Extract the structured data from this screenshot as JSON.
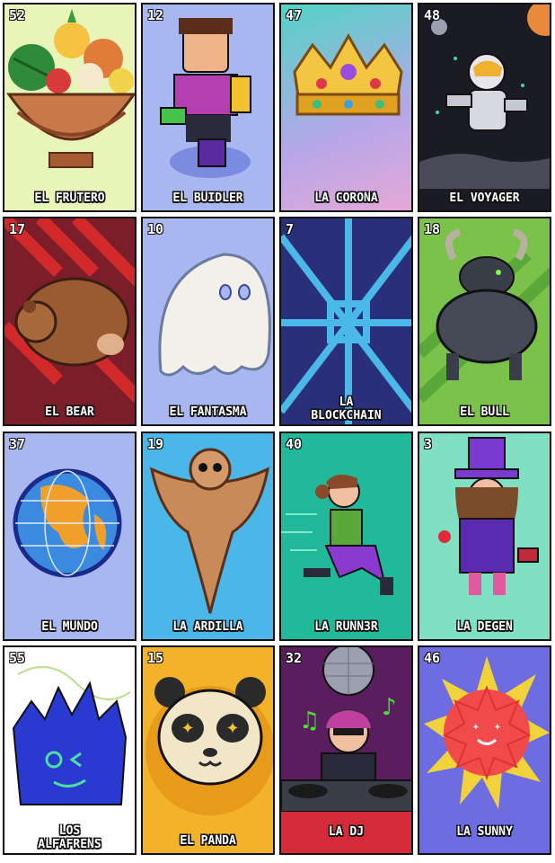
{
  "cards": [
    {
      "number": "52",
      "title": "EL FRUTERO",
      "bg": "#e8f4b8"
    },
    {
      "number": "12",
      "title": "EL BUIDLER",
      "bg": "#a9b7f0"
    },
    {
      "number": "47",
      "title": "LA CORONA",
      "bg": "#b6a7e9"
    },
    {
      "number": "48",
      "title": "EL VOYAGER",
      "bg": "#1b1b24"
    },
    {
      "number": "17",
      "title": "EL BEAR",
      "bg": "#7c1e2a"
    },
    {
      "number": "10",
      "title": "EL FANTASMA",
      "bg": "#a9b7f0"
    },
    {
      "number": "7",
      "title": "LA\nBLOCKCHAIN",
      "bg": "#2a2f7a"
    },
    {
      "number": "18",
      "title": "EL BULL",
      "bg": "#7ac24a"
    },
    {
      "number": "37",
      "title": "EL MUNDO",
      "bg": "#a9b7f0"
    },
    {
      "number": "19",
      "title": "LA ARDILLA",
      "bg": "#4bb6e8"
    },
    {
      "number": "40",
      "title": "LA RUNN3R",
      "bg": "#22b89a"
    },
    {
      "number": "3",
      "title": "LA DEGEN",
      "bg": "#7fe0c4"
    },
    {
      "number": "55",
      "title": "LOS\nALFAFRENS",
      "bg": "#ffffff"
    },
    {
      "number": "15",
      "title": "EL PANDA",
      "bg": "#f2b32a"
    },
    {
      "number": "32",
      "title": "LA DJ",
      "bg": "#5a1e5f"
    },
    {
      "number": "46",
      "title": "LA SUNNY",
      "bg": "#6d6ce0"
    }
  ]
}
